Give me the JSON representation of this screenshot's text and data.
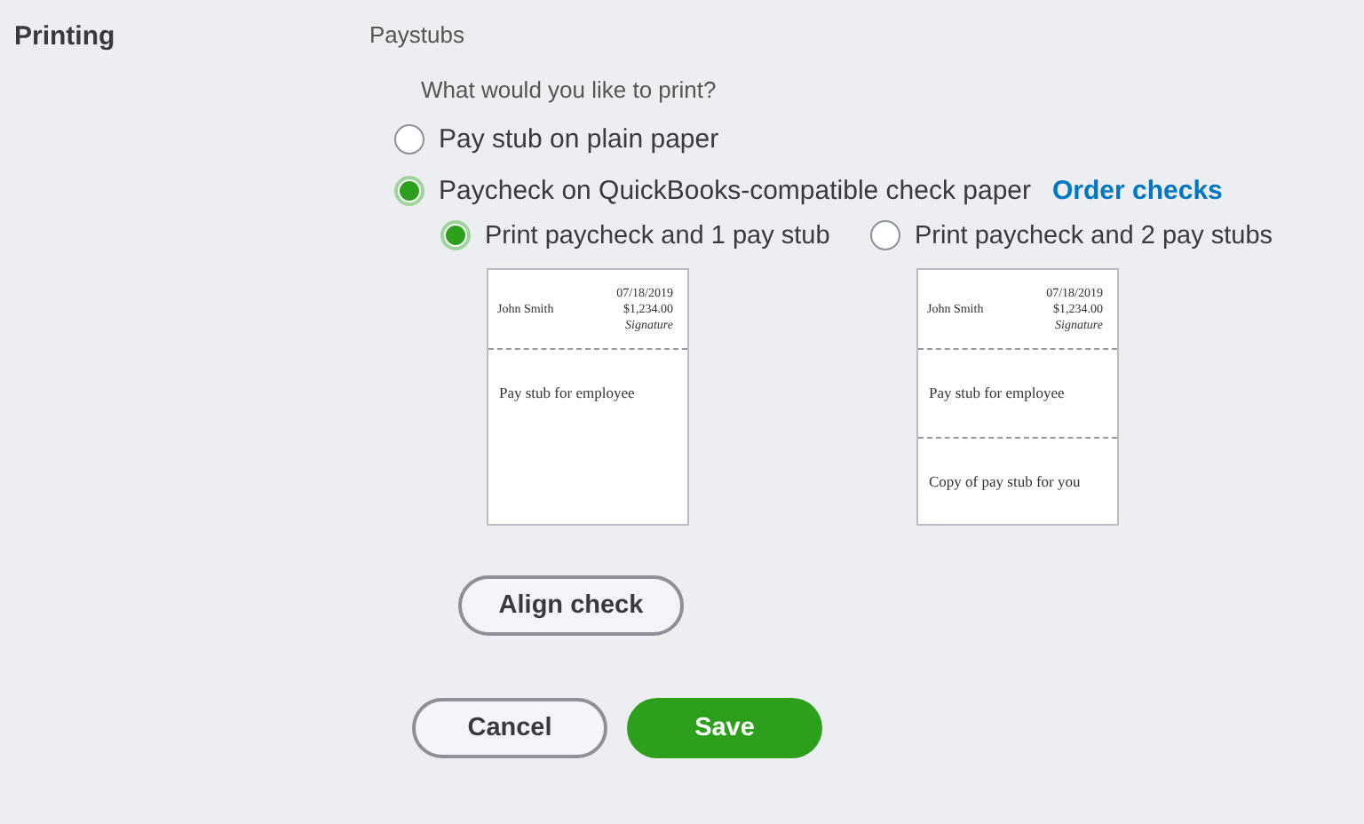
{
  "section": {
    "title": "Printing"
  },
  "paystubs": {
    "heading": "Paystubs",
    "question": "What would you like to print?",
    "options": [
      {
        "label": "Pay stub on plain paper",
        "selected": false
      },
      {
        "label": "Paycheck on QuickBooks-compatible check paper",
        "link": "Order checks",
        "selected": true
      }
    ],
    "layouts": [
      {
        "label": "Print paycheck and 1 pay stub",
        "selected": true,
        "preview": {
          "date": "07/18/2019",
          "payee": "John Smith",
          "amount": "$1,234.00",
          "signature": "Signature",
          "stubs": [
            "Pay stub for employee"
          ]
        }
      },
      {
        "label": "Print paycheck and 2 pay stubs",
        "selected": false,
        "preview": {
          "date": "07/18/2019",
          "payee": "John Smith",
          "amount": "$1,234.00",
          "signature": "Signature",
          "stubs": [
            "Pay stub for employee",
            "Copy of pay stub for you"
          ]
        }
      }
    ]
  },
  "buttons": {
    "align": "Align check",
    "cancel": "Cancel",
    "save": "Save"
  }
}
